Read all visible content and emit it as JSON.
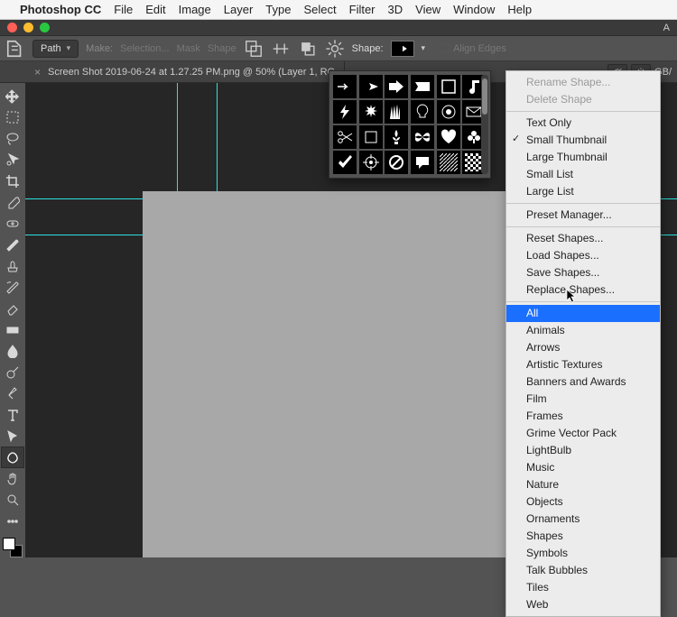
{
  "menubar": {
    "apple": "",
    "app": "Photoshop CC",
    "items": [
      "File",
      "Edit",
      "Image",
      "Layer",
      "Type",
      "Select",
      "Filter",
      "3D",
      "View",
      "Window",
      "Help"
    ]
  },
  "titlebar": {
    "right": "A"
  },
  "options": {
    "mode": "Path",
    "make": "Make:",
    "selection": "Selection...",
    "mask": "Mask",
    "shape_btn": "Shape",
    "shape_label": "Shape:",
    "align": "Align Edges"
  },
  "tab": {
    "title": "Screen Shot 2019-06-24 at 1.27.25 PM.png @ 50% (Layer 1, RG",
    "right": "GB/"
  },
  "tools": [
    {
      "n": "move-tool"
    },
    {
      "n": "marquee-tool"
    },
    {
      "n": "lasso-tool"
    },
    {
      "n": "quick-select-tool"
    },
    {
      "n": "crop-tool"
    },
    {
      "n": "eyedropper-tool"
    },
    {
      "n": "healing-brush-tool"
    },
    {
      "n": "brush-tool"
    },
    {
      "n": "clone-stamp-tool"
    },
    {
      "n": "history-brush-tool"
    },
    {
      "n": "eraser-tool"
    },
    {
      "n": "gradient-tool"
    },
    {
      "n": "blur-tool"
    },
    {
      "n": "dodge-tool"
    },
    {
      "n": "pen-tool"
    },
    {
      "n": "type-tool"
    },
    {
      "n": "path-select-tool"
    },
    {
      "n": "custom-shape-tool",
      "active": true
    },
    {
      "n": "hand-tool"
    },
    {
      "n": "zoom-tool"
    },
    {
      "n": "edit-toolbar"
    }
  ],
  "shape_picker": {
    "shapes": [
      "arrow-1",
      "arrow-2",
      "arrow-3",
      "banner",
      "square-outline",
      "music-note",
      "bolt",
      "burst",
      "grass",
      "bulb",
      "target",
      "envelope",
      "scissors",
      "box",
      "fleur",
      "butterfly",
      "heart",
      "club",
      "checkmark",
      "registration",
      "no-sign",
      "speech",
      "halftone",
      "checker"
    ]
  },
  "ctx": {
    "groups": [
      [
        {
          "label": "Rename Shape...",
          "disabled": true
        },
        {
          "label": "Delete Shape",
          "disabled": true
        }
      ],
      [
        {
          "label": "Text Only"
        },
        {
          "label": "Small Thumbnail",
          "checked": true
        },
        {
          "label": "Large Thumbnail"
        },
        {
          "label": "Small List"
        },
        {
          "label": "Large List"
        }
      ],
      [
        {
          "label": "Preset Manager..."
        }
      ],
      [
        {
          "label": "Reset Shapes..."
        },
        {
          "label": "Load Shapes..."
        },
        {
          "label": "Save Shapes..."
        },
        {
          "label": "Replace Shapes..."
        }
      ],
      [
        {
          "label": "All",
          "highlight": true
        },
        {
          "label": "Animals"
        },
        {
          "label": "Arrows"
        },
        {
          "label": "Artistic Textures"
        },
        {
          "label": "Banners and Awards"
        },
        {
          "label": "Film"
        },
        {
          "label": "Frames"
        },
        {
          "label": "Grime Vector Pack"
        },
        {
          "label": "LightBulb"
        },
        {
          "label": "Music"
        },
        {
          "label": "Nature"
        },
        {
          "label": "Objects"
        },
        {
          "label": "Ornaments"
        },
        {
          "label": "Shapes"
        },
        {
          "label": "Symbols"
        },
        {
          "label": "Talk Bubbles"
        },
        {
          "label": "Tiles"
        },
        {
          "label": "Web"
        }
      ]
    ]
  }
}
